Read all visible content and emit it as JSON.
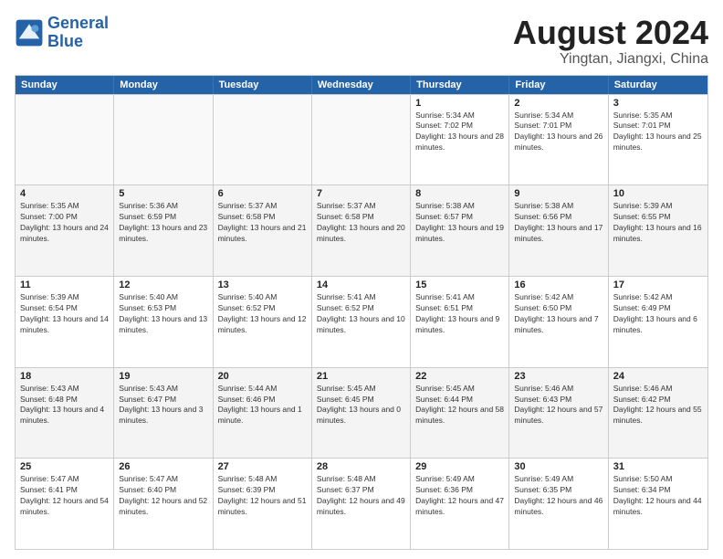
{
  "logo": {
    "text_general": "General",
    "text_blue": "Blue"
  },
  "title": "August 2024",
  "subtitle": "Yingtan, Jiangxi, China",
  "header_days": [
    "Sunday",
    "Monday",
    "Tuesday",
    "Wednesday",
    "Thursday",
    "Friday",
    "Saturday"
  ],
  "rows": [
    [
      {
        "day": "",
        "empty": true
      },
      {
        "day": "",
        "empty": true
      },
      {
        "day": "",
        "empty": true
      },
      {
        "day": "",
        "empty": true
      },
      {
        "day": "1",
        "sunrise": "5:34 AM",
        "sunset": "7:02 PM",
        "daylight": "13 hours and 28 minutes."
      },
      {
        "day": "2",
        "sunrise": "5:34 AM",
        "sunset": "7:01 PM",
        "daylight": "13 hours and 26 minutes."
      },
      {
        "day": "3",
        "sunrise": "5:35 AM",
        "sunset": "7:01 PM",
        "daylight": "13 hours and 25 minutes."
      }
    ],
    [
      {
        "day": "4",
        "sunrise": "5:35 AM",
        "sunset": "7:00 PM",
        "daylight": "13 hours and 24 minutes.",
        "shaded": true
      },
      {
        "day": "5",
        "sunrise": "5:36 AM",
        "sunset": "6:59 PM",
        "daylight": "13 hours and 23 minutes.",
        "shaded": true
      },
      {
        "day": "6",
        "sunrise": "5:37 AM",
        "sunset": "6:58 PM",
        "daylight": "13 hours and 21 minutes.",
        "shaded": true
      },
      {
        "day": "7",
        "sunrise": "5:37 AM",
        "sunset": "6:58 PM",
        "daylight": "13 hours and 20 minutes.",
        "shaded": true
      },
      {
        "day": "8",
        "sunrise": "5:38 AM",
        "sunset": "6:57 PM",
        "daylight": "13 hours and 19 minutes.",
        "shaded": true
      },
      {
        "day": "9",
        "sunrise": "5:38 AM",
        "sunset": "6:56 PM",
        "daylight": "13 hours and 17 minutes.",
        "shaded": true
      },
      {
        "day": "10",
        "sunrise": "5:39 AM",
        "sunset": "6:55 PM",
        "daylight": "13 hours and 16 minutes.",
        "shaded": true
      }
    ],
    [
      {
        "day": "11",
        "sunrise": "5:39 AM",
        "sunset": "6:54 PM",
        "daylight": "13 hours and 14 minutes."
      },
      {
        "day": "12",
        "sunrise": "5:40 AM",
        "sunset": "6:53 PM",
        "daylight": "13 hours and 13 minutes."
      },
      {
        "day": "13",
        "sunrise": "5:40 AM",
        "sunset": "6:52 PM",
        "daylight": "13 hours and 12 minutes."
      },
      {
        "day": "14",
        "sunrise": "5:41 AM",
        "sunset": "6:52 PM",
        "daylight": "13 hours and 10 minutes."
      },
      {
        "day": "15",
        "sunrise": "5:41 AM",
        "sunset": "6:51 PM",
        "daylight": "13 hours and 9 minutes."
      },
      {
        "day": "16",
        "sunrise": "5:42 AM",
        "sunset": "6:50 PM",
        "daylight": "13 hours and 7 minutes."
      },
      {
        "day": "17",
        "sunrise": "5:42 AM",
        "sunset": "6:49 PM",
        "daylight": "13 hours and 6 minutes."
      }
    ],
    [
      {
        "day": "18",
        "sunrise": "5:43 AM",
        "sunset": "6:48 PM",
        "daylight": "13 hours and 4 minutes.",
        "shaded": true
      },
      {
        "day": "19",
        "sunrise": "5:43 AM",
        "sunset": "6:47 PM",
        "daylight": "13 hours and 3 minutes.",
        "shaded": true
      },
      {
        "day": "20",
        "sunrise": "5:44 AM",
        "sunset": "6:46 PM",
        "daylight": "13 hours and 1 minute.",
        "shaded": true
      },
      {
        "day": "21",
        "sunrise": "5:45 AM",
        "sunset": "6:45 PM",
        "daylight": "13 hours and 0 minutes.",
        "shaded": true
      },
      {
        "day": "22",
        "sunrise": "5:45 AM",
        "sunset": "6:44 PM",
        "daylight": "12 hours and 58 minutes.",
        "shaded": true
      },
      {
        "day": "23",
        "sunrise": "5:46 AM",
        "sunset": "6:43 PM",
        "daylight": "12 hours and 57 minutes.",
        "shaded": true
      },
      {
        "day": "24",
        "sunrise": "5:46 AM",
        "sunset": "6:42 PM",
        "daylight": "12 hours and 55 minutes.",
        "shaded": true
      }
    ],
    [
      {
        "day": "25",
        "sunrise": "5:47 AM",
        "sunset": "6:41 PM",
        "daylight": "12 hours and 54 minutes."
      },
      {
        "day": "26",
        "sunrise": "5:47 AM",
        "sunset": "6:40 PM",
        "daylight": "12 hours and 52 minutes."
      },
      {
        "day": "27",
        "sunrise": "5:48 AM",
        "sunset": "6:39 PM",
        "daylight": "12 hours and 51 minutes."
      },
      {
        "day": "28",
        "sunrise": "5:48 AM",
        "sunset": "6:37 PM",
        "daylight": "12 hours and 49 minutes."
      },
      {
        "day": "29",
        "sunrise": "5:49 AM",
        "sunset": "6:36 PM",
        "daylight": "12 hours and 47 minutes."
      },
      {
        "day": "30",
        "sunrise": "5:49 AM",
        "sunset": "6:35 PM",
        "daylight": "12 hours and 46 minutes."
      },
      {
        "day": "31",
        "sunrise": "5:50 AM",
        "sunset": "6:34 PM",
        "daylight": "12 hours and 44 minutes."
      }
    ]
  ]
}
